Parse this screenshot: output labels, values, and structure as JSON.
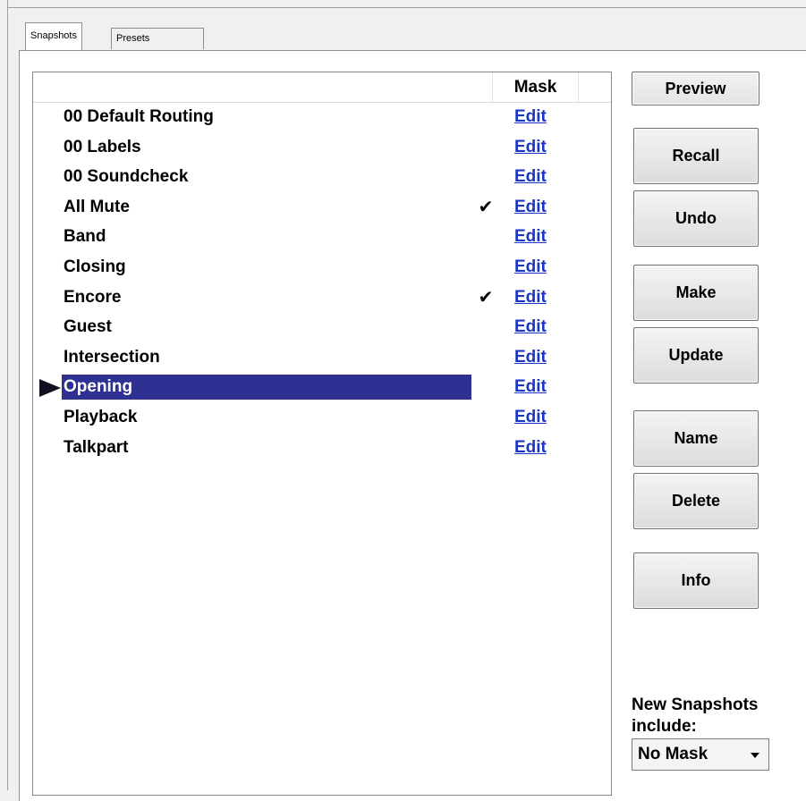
{
  "tabs": [
    {
      "label": "Snapshots",
      "active": true
    },
    {
      "label": "Presets",
      "active": false
    }
  ],
  "list": {
    "header": {
      "mask": "Mask"
    },
    "rows": [
      {
        "name": "00 Default Routing",
        "check": "",
        "edit": "Edit"
      },
      {
        "name": "00 Labels",
        "check": "",
        "edit": "Edit"
      },
      {
        "name": "00 Soundcheck",
        "check": "",
        "edit": "Edit"
      },
      {
        "name": "All Mute",
        "check": "✔",
        "edit": "Edit"
      },
      {
        "name": "Band",
        "check": "",
        "edit": "Edit"
      },
      {
        "name": "Closing",
        "check": "",
        "edit": "Edit"
      },
      {
        "name": "Encore",
        "check": "✔",
        "edit": "Edit"
      },
      {
        "name": "Guest",
        "check": "",
        "edit": "Edit"
      },
      {
        "name": "Intersection",
        "check": "",
        "edit": "Edit"
      },
      {
        "name": "Opening",
        "check": "",
        "edit": "Edit",
        "selected": true
      },
      {
        "name": "Playback",
        "check": "",
        "edit": "Edit"
      },
      {
        "name": "Talkpart",
        "check": "",
        "edit": "Edit"
      }
    ]
  },
  "buttons": {
    "preview": "Preview",
    "recall": "Recall",
    "undo": "Undo",
    "make": "Make",
    "update": "Update",
    "name": "Name",
    "delete": "Delete",
    "info": "Info"
  },
  "new_snapshots": {
    "caption": "New Snapshots include:",
    "selected": "No Mask"
  },
  "colors": {
    "selection": "#2e3192",
    "link": "#1a36c4"
  }
}
